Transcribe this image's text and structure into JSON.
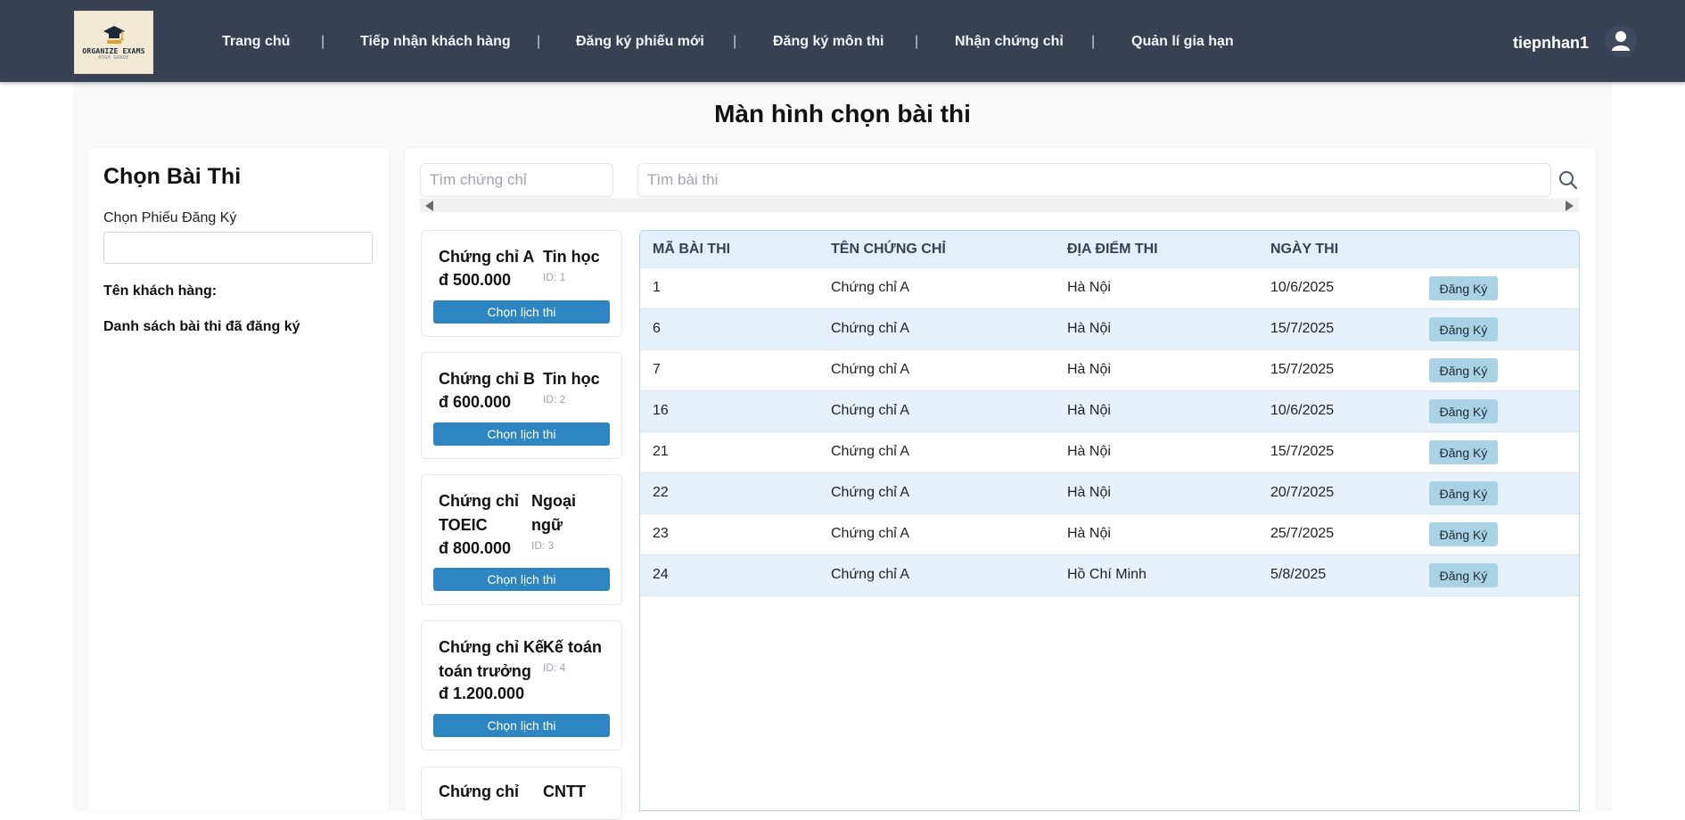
{
  "header": {
    "logo": {
      "line1": "ORGANIZE EXAMS",
      "line2": "HIGH GRADE"
    },
    "nav": [
      {
        "label": "Trang chủ"
      },
      {
        "label": "Tiếp nhận khách hàng"
      },
      {
        "label": "Đăng ký phiếu mới"
      },
      {
        "label": "Đăng ký môn thi"
      },
      {
        "label": "Nhận chứng chỉ"
      },
      {
        "label": "Quản lí gia hạn"
      }
    ],
    "separator": "|",
    "username": "tiepnhan1",
    "user_icon": "user-icon"
  },
  "page_title": "Màn hình chọn bài thi",
  "left_panel": {
    "title": "Chọn Bài Thi",
    "registration_label": "Chọn Phiếu Đăng Ký",
    "registration_value": "",
    "customer_label": "Tên khách hàng:",
    "registered_list_label": "Danh sách bài thi đã đăng ký"
  },
  "search": {
    "cert_placeholder": "Tìm chứng chỉ",
    "exam_placeholder": "Tìm bài thi",
    "search_icon": "search-icon"
  },
  "certificates": [
    {
      "name_l1": "Chứng chỉ A",
      "name_l2": "",
      "category_l1": "Tin học",
      "category_l2": "",
      "id": "ID: 1",
      "price": "đ 500.000",
      "button": "Chọn lịch thi"
    },
    {
      "name_l1": "Chứng chỉ B",
      "name_l2": "",
      "category_l1": "Tin học",
      "category_l2": "",
      "id": "ID: 2",
      "price": "đ 600.000",
      "button": "Chọn lịch thi"
    },
    {
      "name_l1": "Chứng chỉ",
      "name_l2": "TOEIC",
      "category_l1": "Ngoại",
      "category_l2": "ngữ",
      "id": "ID: 3",
      "price": "đ 800.000",
      "button": "Chọn lịch thi"
    },
    {
      "name_l1": "Chứng chỉ Kế",
      "name_l2": "toán trưởng",
      "category_l1": "Kế toán",
      "category_l2": "",
      "id": "ID: 4",
      "price": "đ 1.200.000",
      "button": "Chọn lịch thi"
    },
    {
      "name_l1": "Chứng chỉ",
      "name_l2": "",
      "category_l1": "CNTT",
      "category_l2": "",
      "id": "",
      "price": "",
      "button": ""
    }
  ],
  "exam_table": {
    "columns": [
      "MÃ BÀI THI",
      "TÊN CHỨNG CHỈ",
      "ĐỊA ĐIỂM THI",
      "NGÀY THI"
    ],
    "rows": [
      {
        "id": "1",
        "cert": "Chứng chỉ A",
        "location": "Hà Nội",
        "date": "10/6/2025",
        "button": "Đăng Ký"
      },
      {
        "id": "6",
        "cert": "Chứng chỉ A",
        "location": "Hà Nội",
        "date": "15/7/2025",
        "button": "Đăng Ký"
      },
      {
        "id": "7",
        "cert": "Chứng chỉ A",
        "location": "Hà Nội",
        "date": "15/7/2025",
        "button": "Đăng Ký"
      },
      {
        "id": "16",
        "cert": "Chứng chỉ A",
        "location": "Hà Nội",
        "date": "10/6/2025",
        "button": "Đăng Ký"
      },
      {
        "id": "21",
        "cert": "Chứng chỉ A",
        "location": "Hà Nội",
        "date": "15/7/2025",
        "button": "Đăng Ký"
      },
      {
        "id": "22",
        "cert": "Chứng chỉ A",
        "location": "Hà Nội",
        "date": "20/7/2025",
        "button": "Đăng Ký"
      },
      {
        "id": "23",
        "cert": "Chứng chỉ A",
        "location": "Hà Nội",
        "date": "25/7/2025",
        "button": "Đăng Ký"
      },
      {
        "id": "24",
        "cert": "Chứng chỉ A",
        "location": "Hồ Chí Minh",
        "date": "5/8/2025",
        "button": "Đăng Ký"
      }
    ]
  },
  "colors": {
    "header_bg": "#374151",
    "primary_button": "#2d86c2",
    "register_button": "#a9d2e4",
    "table_header_bg": "#e3effb",
    "table_row_alt": "#e6f1fd"
  }
}
